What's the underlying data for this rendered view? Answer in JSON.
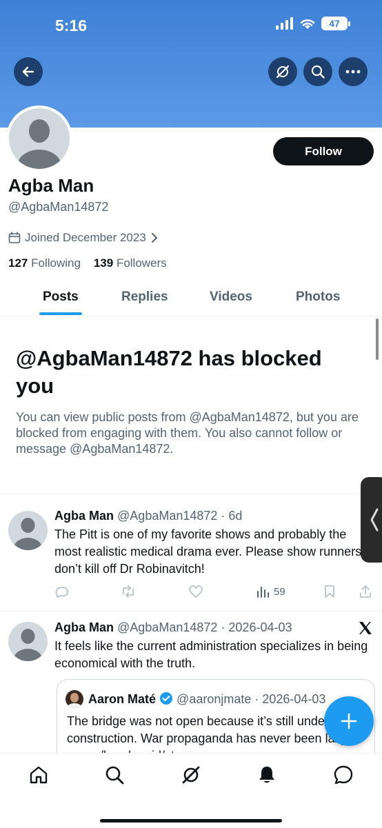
{
  "status_bar": {
    "time": "5:16",
    "battery": "47"
  },
  "profile": {
    "name": "Agba Man",
    "handle": "@AgbaMan14872",
    "joined": "Joined December 2023",
    "following_count": "127",
    "following_label": "Following",
    "followers_count": "139",
    "followers_label": "Followers",
    "follow_label": "Follow"
  },
  "tabs": [
    "Posts",
    "Replies",
    "Videos",
    "Photos"
  ],
  "blocked": {
    "title": "@AgbaMan14872 has blocked you",
    "text": "You can view public posts from @AgbaMan14872, but you are blocked from engaging with them. You also cannot follow or message @AgbaMan14872."
  },
  "posts": [
    {
      "name": "Agba Man",
      "meta": "@AgbaMan14872 · 6d",
      "text": "The Pitt is one of my favorite shows and probably the most realistic medical drama ever. Please show runners don’t kill off Dr Robinavitch!",
      "views": "59"
    },
    {
      "name": "Agba Man",
      "meta": "@AgbaMan14872 · 2026-04-03",
      "text": "It feels like the current administration specializes in being economical with the truth.",
      "quote": {
        "name": "Aaron Maté",
        "meta": "@aaronjmate · 2026-04-03",
        "text": "The bridge was not open because it’s still under construction. War propaganda has never been lazy. x.com/barakravid/sta..."
      }
    }
  ],
  "colors": {
    "accent": "#1d9bf0",
    "banner": "#4a8ce0",
    "text": "#0f1419",
    "muted": "#536471"
  }
}
